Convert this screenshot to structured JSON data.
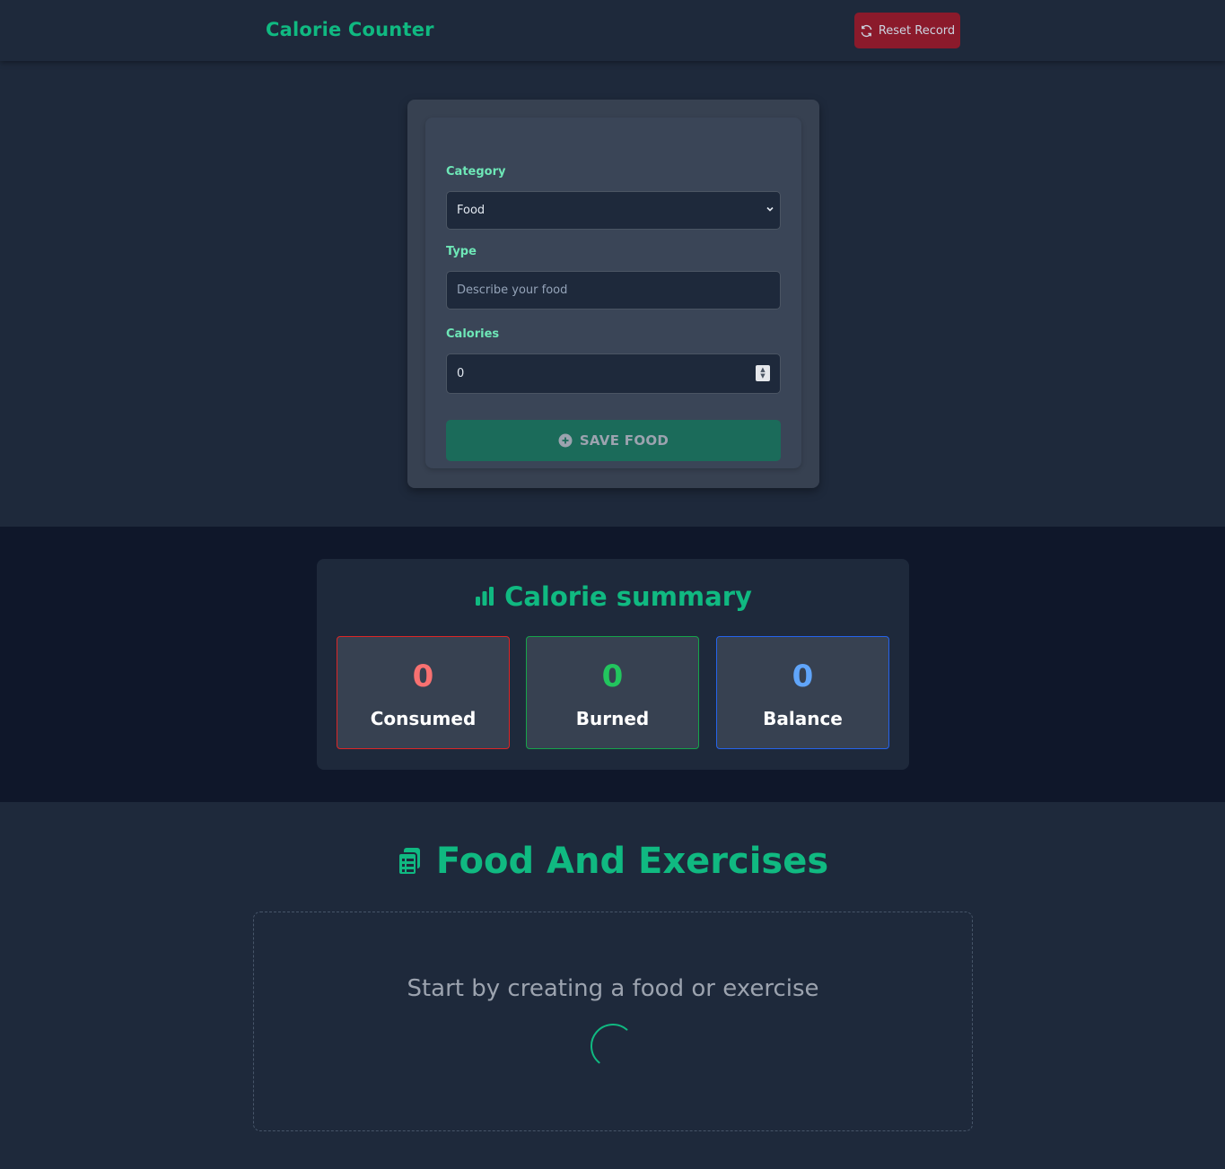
{
  "header": {
    "title": "Calorie Counter",
    "reset_label": "Reset Record"
  },
  "form": {
    "category_label": "Category",
    "category_value": "Food",
    "type_label": "Type",
    "type_placeholder": "Describe your food",
    "calories_label": "Calories",
    "calories_value": "0",
    "save_label": "SAVE FOOD"
  },
  "summary": {
    "title": "Calorie summary",
    "stats": [
      {
        "value": "0",
        "label": "Consumed",
        "color": "#f87171",
        "border": "#dc2626"
      },
      {
        "value": "0",
        "label": "Burned",
        "color": "#22c55e",
        "border": "#16a34a"
      },
      {
        "value": "0",
        "label": "Balance",
        "color": "#60a5fa",
        "border": "#2563eb"
      }
    ]
  },
  "list": {
    "title": "Food And Exercises",
    "empty_text": "Start by creating a food or exercise"
  },
  "colors": {
    "accent": "#10b981",
    "reset_bg": "#8b1a2b",
    "save_bg": "#1b6b5a"
  },
  "icons": {
    "reset": "refresh-icon",
    "save": "plus-circle-icon",
    "summary": "bar-chart-icon",
    "list": "clipboard-list-icon",
    "loading": "spinner-icon"
  }
}
